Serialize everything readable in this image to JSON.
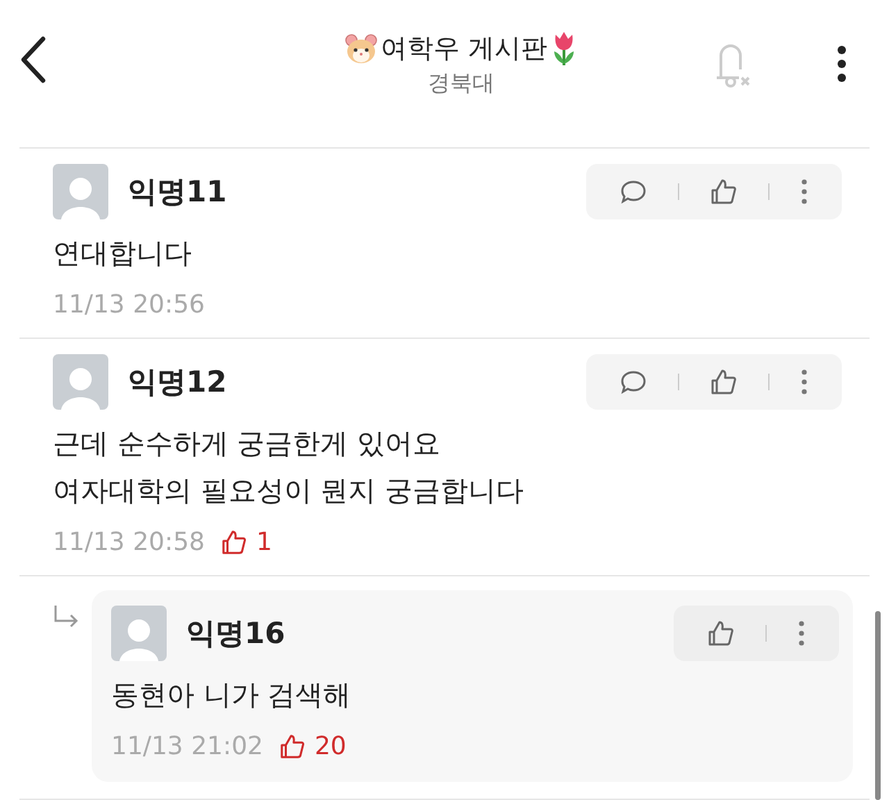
{
  "header": {
    "title": "여학우 게시판",
    "subtitle": "경북대"
  },
  "comments": [
    {
      "kind": "comment",
      "author": "익명11",
      "body": "연대합니다",
      "time": "11/13 20:56",
      "actions": [
        {
          "kind": "reply"
        },
        {
          "kind": "like"
        },
        {
          "kind": "more"
        }
      ]
    },
    {
      "kind": "comment",
      "author": "익명12",
      "body": "근데 순수하게 궁금한게 있어요\n여자대학의 필요성이 뭔지 궁금합니다",
      "time": "11/13 20:58",
      "likes": "1",
      "actions": [
        {
          "kind": "reply"
        },
        {
          "kind": "like"
        },
        {
          "kind": "more"
        }
      ]
    },
    {
      "kind": "reply",
      "author": "익명16",
      "body": "동현아 니가 검색해",
      "time": "11/13 21:02",
      "likes": "20",
      "actions": [
        {
          "kind": "like"
        },
        {
          "kind": "more"
        }
      ]
    }
  ]
}
